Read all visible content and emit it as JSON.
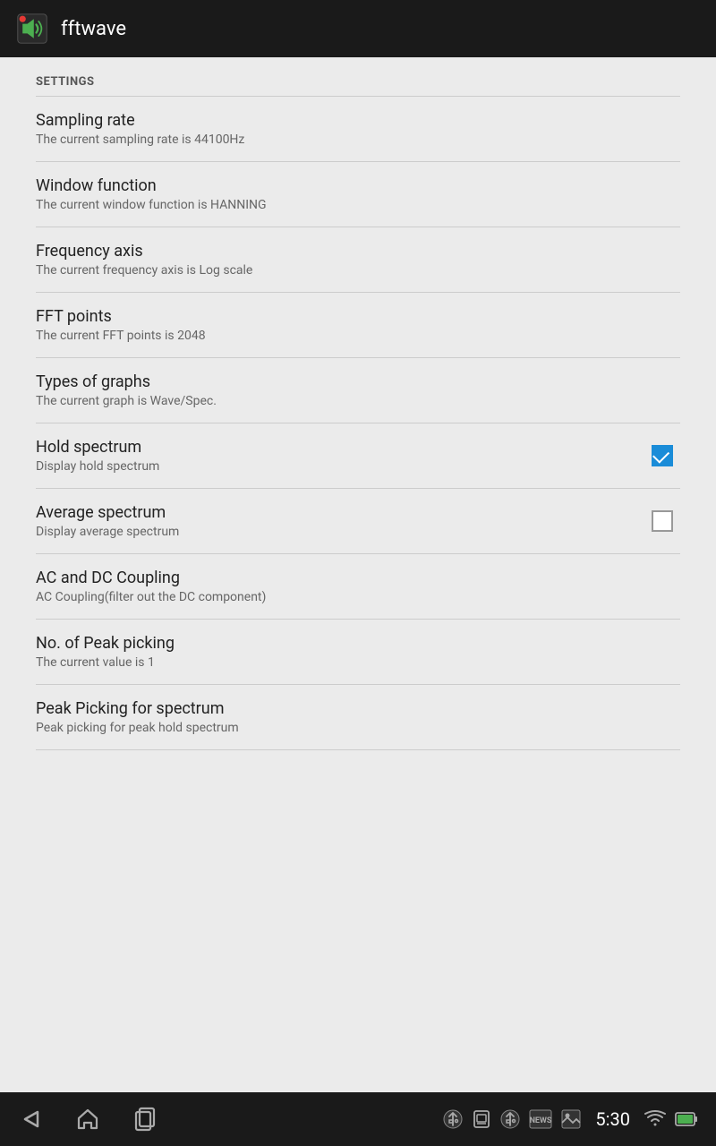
{
  "appBar": {
    "title": "fftwave",
    "iconAlt": "fftwave-app-icon"
  },
  "settingsHeader": "SETTINGS",
  "settings": [
    {
      "id": "sampling-rate",
      "title": "Sampling rate",
      "subtitle": "The current sampling rate is 44100Hz",
      "hasControl": false
    },
    {
      "id": "window-function",
      "title": "Window function",
      "subtitle": "The current window function is HANNING",
      "hasControl": false
    },
    {
      "id": "frequency-axis",
      "title": "Frequency axis",
      "subtitle": "The current frequency axis is Log scale",
      "hasControl": false
    },
    {
      "id": "fft-points",
      "title": "FFT points",
      "subtitle": "The current FFT points is 2048",
      "hasControl": false
    },
    {
      "id": "types-of-graphs",
      "title": "Types of graphs",
      "subtitle": "The current graph is Wave/Spec.",
      "hasControl": false
    },
    {
      "id": "hold-spectrum",
      "title": "Hold spectrum",
      "subtitle": "Display hold spectrum",
      "hasControl": true,
      "checked": true
    },
    {
      "id": "average-spectrum",
      "title": "Average spectrum",
      "subtitle": "Display average spectrum",
      "hasControl": true,
      "checked": false
    },
    {
      "id": "ac-dc-coupling",
      "title": "AC and DC Coupling",
      "subtitle": "AC Coupling(filter out the DC component)",
      "hasControl": false
    },
    {
      "id": "peak-picking-no",
      "title": "No. of Peak picking",
      "subtitle": "The current value is 1",
      "hasControl": false
    },
    {
      "id": "peak-picking-spectrum",
      "title": "Peak Picking for spectrum",
      "subtitle": "Peak picking for peak hold spectrum",
      "hasControl": false
    }
  ],
  "navBar": {
    "time": "5:30",
    "backIcon": "◁",
    "homeIcon": "△",
    "recentIcon": "□"
  }
}
